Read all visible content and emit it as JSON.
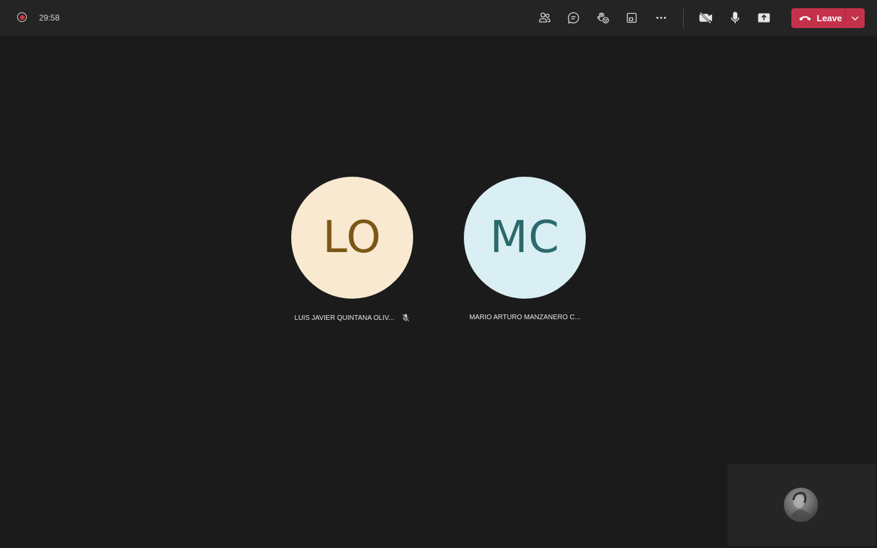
{
  "meeting": {
    "timer": "29:58",
    "recording": true
  },
  "toolbar": {
    "buttons": [
      {
        "name": "people",
        "icon": "people-icon"
      },
      {
        "name": "chat",
        "icon": "chat-icon"
      },
      {
        "name": "reactions",
        "icon": "raise-hand-react-icon"
      },
      {
        "name": "view",
        "icon": "window-view-icon"
      },
      {
        "name": "more",
        "icon": "more-options-icon"
      },
      {
        "name": "camera",
        "icon": "camera-off-icon"
      },
      {
        "name": "mic",
        "icon": "microphone-icon"
      },
      {
        "name": "share",
        "icon": "share-screen-icon"
      }
    ],
    "leave_label": "Leave"
  },
  "participants": [
    {
      "initials": "LO",
      "name": "LUIS JAVIER QUINTANA OLIV...",
      "muted": true,
      "avatar_bg": "#f8e9d0",
      "avatar_fg": "#7b5715"
    },
    {
      "initials": "MC",
      "name": "MARIO ARTURO MANZANERO C...",
      "muted": false,
      "avatar_bg": "#daeff3",
      "avatar_fg": "#2b6a6c"
    }
  ],
  "colors": {
    "background": "#1b1b1b",
    "topbar": "#242424",
    "leave": "#c4314b",
    "recording": "#d13438"
  }
}
